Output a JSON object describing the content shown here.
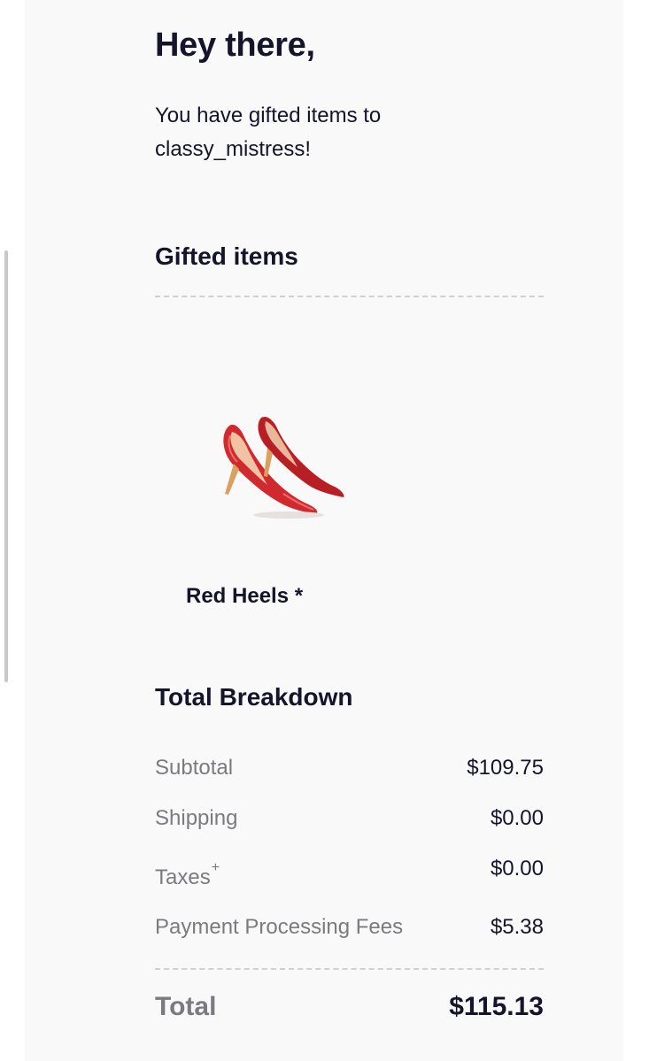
{
  "email": {
    "greeting": "Hey there,",
    "intro": "You have gifted items to classy_mistress!"
  },
  "gifted": {
    "title": "Gifted items",
    "items": [
      {
        "name": "Red Heels *",
        "image": "red-high-heels"
      }
    ]
  },
  "breakdown": {
    "title": "Total Breakdown",
    "subtotal": {
      "label": "Subtotal",
      "value": "$109.75"
    },
    "shipping": {
      "label": "Shipping",
      "value": "$0.00"
    },
    "taxes": {
      "label": "Taxes",
      "marker": "+",
      "value": "$0.00"
    },
    "fees": {
      "label": "Payment Processing Fees",
      "value": "$5.38"
    },
    "total": {
      "label": "Total",
      "value": "$115.13"
    }
  },
  "colors": {
    "heading": "#14142b",
    "muted": "#7a7a80",
    "card_background": "#faf9f9",
    "shoe_red": "#c8262a"
  }
}
